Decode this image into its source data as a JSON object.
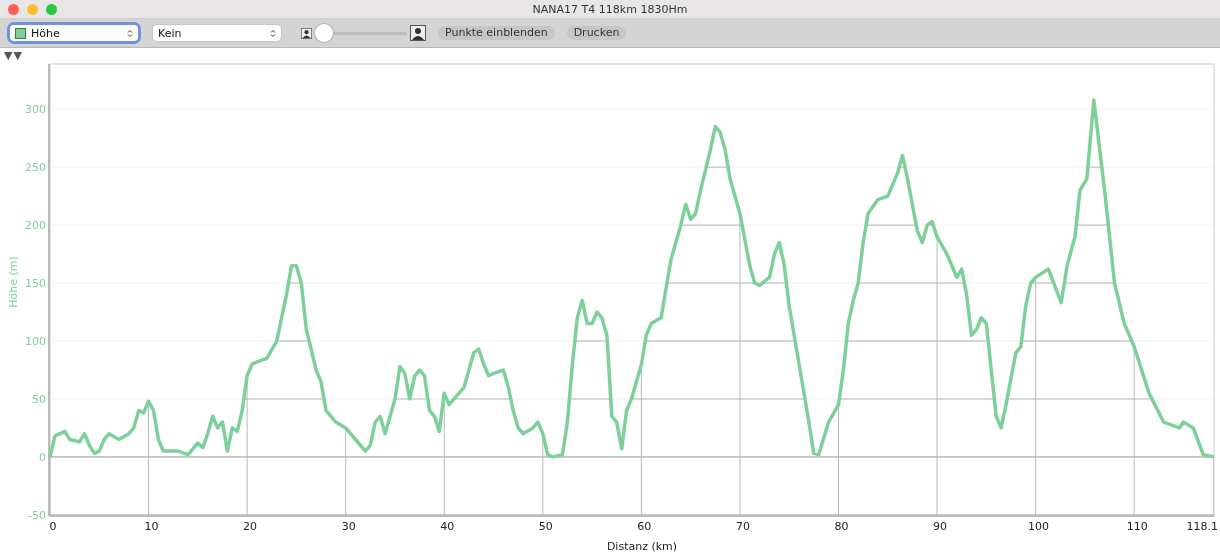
{
  "window": {
    "title": "NANA17 T4 118km 1830Hm"
  },
  "toolbar": {
    "primary_select": {
      "value": "Höhe",
      "color": "#7ed09a",
      "focused": true
    },
    "secondary_select": {
      "value": "Kein"
    },
    "zoom_slider": {
      "level": 0
    },
    "buttons": [
      "Punkte einblenden",
      "Drucken"
    ]
  },
  "chart": {
    "chart_data": {
      "type": "line",
      "xlabel": "Distanz (km)",
      "ylabel": "Höhe (m)",
      "xlim": [
        0,
        118.1
      ],
      "ylim": [
        -51,
        339
      ],
      "xticks": [
        0,
        10,
        20,
        30,
        40,
        50,
        60,
        70,
        80,
        90,
        100,
        110,
        118.1
      ],
      "yticks": [
        -50,
        0,
        50,
        100,
        150,
        200,
        250,
        300
      ],
      "x": [
        0,
        0.5,
        1,
        1.5,
        2,
        3,
        3.5,
        4,
        4.5,
        5,
        5.5,
        6,
        7,
        8,
        8.5,
        9,
        9.5,
        10,
        10.5,
        11,
        11.5,
        12,
        13,
        14,
        15,
        15.5,
        16,
        16.5,
        17,
        17.5,
        18,
        18.5,
        19,
        19.5,
        20,
        20.5,
        21,
        22,
        23,
        24,
        24.5,
        25,
        25.5,
        26,
        27,
        27.5,
        28,
        29,
        30,
        31,
        32,
        32.5,
        33,
        33.5,
        34,
        35,
        35.5,
        36,
        36.5,
        37,
        37.5,
        38,
        38.5,
        39,
        39.5,
        40,
        40.5,
        41,
        42,
        42.5,
        43,
        43.5,
        44,
        44.5,
        45,
        46,
        46.5,
        47,
        47.5,
        48,
        49,
        49.5,
        50,
        50.5,
        51,
        52,
        52.5,
        53,
        53.5,
        54,
        54.5,
        55,
        55.5,
        56,
        56.5,
        57,
        57.5,
        58,
        58.5,
        59,
        60,
        60.5,
        61,
        62,
        62.5,
        63,
        64,
        64.5,
        65,
        65.5,
        66,
        67,
        67.5,
        68,
        68.5,
        69,
        70,
        71,
        71.5,
        72,
        73,
        73.5,
        74,
        74.5,
        75,
        76,
        77,
        77.5,
        78,
        79,
        80,
        80.5,
        81,
        81.5,
        82,
        82.5,
        83,
        84,
        85,
        85.5,
        86,
        86.5,
        87,
        88,
        88.5,
        89,
        89.5,
        90,
        91,
        92,
        92.5,
        93,
        93.5,
        94,
        94.5,
        95,
        96,
        96.5,
        97,
        98,
        98.5,
        99,
        99.5,
        100,
        101.3,
        102.6,
        103.2,
        104,
        104.5,
        105.2,
        105.9,
        107,
        108,
        109,
        110,
        111.5,
        113,
        114.6,
        115,
        116,
        117,
        118.1
      ],
      "grid": true,
      "series": [
        {
          "color": "#7ed09a",
          "values": [
            0,
            18,
            20,
            22,
            15,
            13,
            20,
            10,
            3,
            5,
            15,
            20,
            15,
            20,
            25,
            40,
            38,
            48,
            40,
            15,
            5,
            5,
            5,
            2,
            12,
            8,
            20,
            35,
            25,
            30,
            5,
            25,
            22,
            40,
            70,
            80,
            82,
            85,
            100,
            140,
            165,
            165,
            150,
            110,
            75,
            65,
            40,
            30,
            25,
            15,
            5,
            10,
            30,
            35,
            20,
            50,
            78,
            72,
            50,
            70,
            75,
            70,
            40,
            35,
            22,
            55,
            45,
            50,
            60,
            75,
            90,
            93,
            80,
            70,
            72,
            75,
            60,
            40,
            25,
            20,
            25,
            30,
            20,
            2,
            0,
            2,
            30,
            80,
            120,
            135,
            115,
            115,
            125,
            120,
            105,
            35,
            30,
            7,
            40,
            50,
            80,
            105,
            115,
            120,
            145,
            170,
            200,
            218,
            205,
            210,
            230,
            265,
            285,
            280,
            265,
            240,
            210,
            165,
            150,
            148,
            155,
            175,
            185,
            165,
            130,
            80,
            30,
            3,
            2,
            30,
            45,
            75,
            115,
            135,
            150,
            185,
            210,
            222,
            225,
            235,
            245,
            260,
            240,
            195,
            185,
            200,
            203,
            190,
            175,
            155,
            162,
            140,
            105,
            110,
            120,
            115,
            35,
            25,
            45,
            90,
            95,
            130,
            150,
            155,
            162,
            133,
            165,
            190,
            230,
            240,
            308,
            230,
            150,
            115,
            95,
            55,
            30,
            25,
            30,
            25,
            2,
            0
          ]
        }
      ]
    }
  },
  "markers": [
    "▼",
    "▼"
  ]
}
